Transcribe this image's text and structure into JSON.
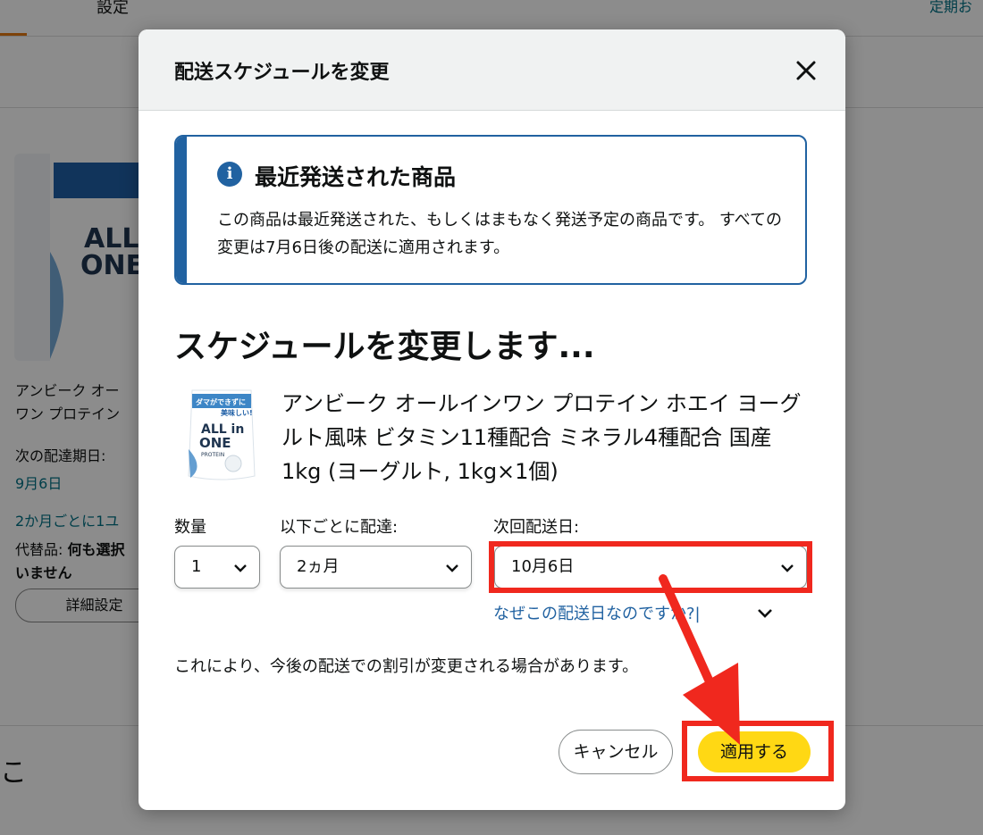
{
  "background": {
    "tab_label": "設定",
    "top_link": "定期お",
    "product_name": "アンビーク オー\nワン プロテイン",
    "next_delivery_label": "次の配達期日:",
    "next_delivery_date": "9月6日",
    "frequency": "2か月ごとに1ユ",
    "substitute_label": "代替品:",
    "substitute_value": "何も選択",
    "substitute_value2": "いません",
    "details_button": "詳細設定",
    "section_letter": "こ"
  },
  "modal": {
    "title": "配送スケジュールを変更",
    "alert": {
      "title": "最近発送された商品",
      "body": "この商品は最近発送された、もしくはまもなく発送予定の商品です。 すべての変更は7月6日後の配送に適用されます。"
    },
    "heading": "スケジュールを変更します...",
    "product": {
      "title": "アンビーク オールインワン プロテイン ホエイ ヨーグルト風味 ビタミン11種配合 ミネラル4種配合 国産 1kg (ヨーグルト, 1kg×1個)",
      "image_text_top": "ダマができずに",
      "image_text_mid": "美味しい!",
      "image_text_brand1": "ALL in",
      "image_text_brand2": "ONE",
      "image_text_protein": "PROTEIN"
    },
    "quantity": {
      "label": "数量",
      "value": "1"
    },
    "frequency": {
      "label": "以下ごとに配達:",
      "value": "2ヵ月"
    },
    "next_date": {
      "label": "次回配送日:",
      "value": "10月6日"
    },
    "why_link": "なぜこの配送日なのですか?|",
    "note": "これにより、今後の配送での割引が変更される場合があります。",
    "cancel_button": "キャンセル",
    "apply_button": "適用する"
  },
  "colors": {
    "accent_blue": "#2162a1",
    "apply_yellow": "#ffd814",
    "highlight_red": "#f0281e"
  }
}
